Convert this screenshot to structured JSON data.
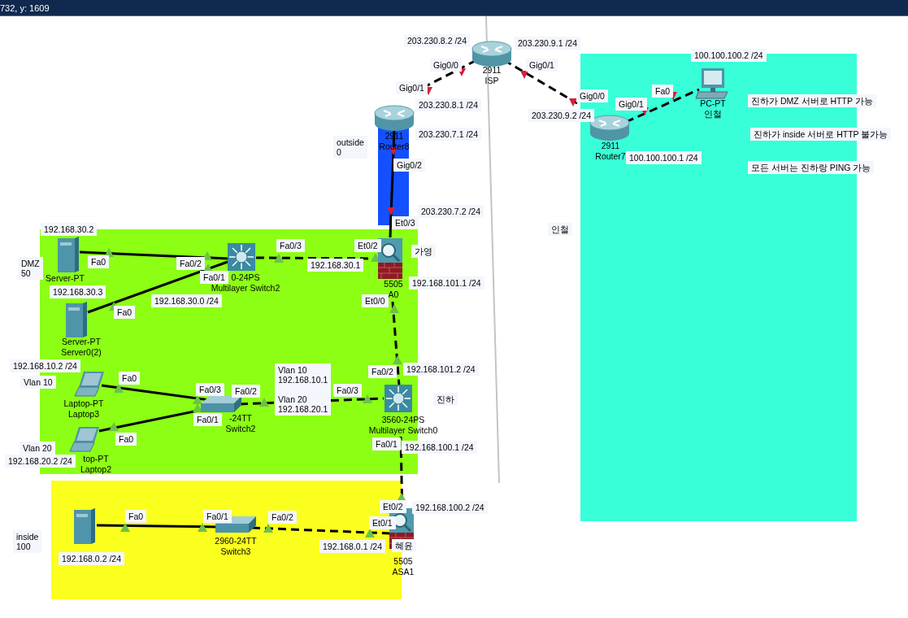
{
  "status_bar": {
    "text": "732, y: 1609"
  },
  "areas": [
    {
      "color": "#1450ff"
    },
    {
      "color": "#8cff14"
    },
    {
      "color": "#fbff1e"
    },
    {
      "color": "#38ffd8"
    }
  ],
  "devices": [
    {
      "kind": "router",
      "model": "2911",
      "name": "ISP"
    },
    {
      "kind": "pc",
      "model": "PC-PT",
      "name": "인철"
    },
    {
      "kind": "router",
      "model": "2911",
      "name": "Router8"
    },
    {
      "kind": "router",
      "model": "2911",
      "name": "Router7"
    },
    {
      "kind": "server",
      "model": "Server-PT"
    },
    {
      "kind": "multilayer-switch",
      "model": "0-24PS",
      "name": "Multilayer Switch2"
    },
    {
      "kind": "firewall",
      "model": "5505",
      "name": "A0"
    },
    {
      "kind": "server",
      "model": "Server-PT",
      "name": "Server0(2)"
    },
    {
      "kind": "laptop",
      "model": "Laptop-PT",
      "name": "Laptop3"
    },
    {
      "kind": "switch",
      "model": "-24TT",
      "name": "Switch2"
    },
    {
      "kind": "multilayer-switch",
      "model": "3560-24PS",
      "name": "Multilayer Switch0"
    },
    {
      "kind": "laptop",
      "model": "top-PT",
      "name": "Laptop2"
    },
    {
      "kind": "server"
    },
    {
      "kind": "switch",
      "model": "2960-24TT",
      "name": "Switch3"
    },
    {
      "kind": "firewall",
      "model": "5505",
      "name": "ASA1"
    }
  ],
  "links": [
    {
      "crossover": true,
      "ends": [
        {
          "up": false
        },
        {
          "up": false
        }
      ]
    },
    {
      "crossover": true,
      "ends": [
        {
          "up": false
        },
        {
          "up": false
        }
      ]
    },
    {
      "crossover": true,
      "ends": [
        {
          "up": false
        },
        {
          "up": false
        }
      ]
    },
    {
      "crossover": false,
      "ends": [
        {
          "up": false
        },
        {
          "up": false
        }
      ]
    },
    {
      "crossover": true,
      "ends": [
        {
          "up": true
        },
        {
          "up": true
        }
      ]
    },
    {
      "crossover": true,
      "ends": [
        {
          "up": true
        },
        {
          "up": true
        }
      ]
    },
    {
      "crossover": false,
      "ends": [
        {
          "up": true
        },
        {
          "up": true
        }
      ]
    },
    {
      "crossover": false,
      "ends": [
        {
          "up": true
        },
        {
          "up": true
        }
      ]
    },
    {
      "crossover": false,
      "ends": [
        {
          "up": true
        },
        {
          "up": true
        }
      ]
    },
    {
      "crossover": false,
      "ends": [
        {
          "up": true
        },
        {
          "up": true
        }
      ]
    },
    {
      "crossover": true,
      "ends": [
        {
          "up": true
        },
        {
          "up": true
        }
      ]
    },
    {
      "crossover": true,
      "ends": [
        {
          "up": true
        },
        {
          "up": true
        }
      ]
    },
    {
      "crossover": false,
      "ends": [
        {
          "up": true
        },
        {
          "up": true
        }
      ]
    },
    {
      "crossover": true,
      "ends": [
        {
          "up": true
        },
        {
          "up": true
        }
      ]
    }
  ],
  "labels": [
    "203.230.8.2 /24",
    "203.230.9.1 /24",
    "Gig0/0",
    "Gig0/1",
    "100.100.100.2 /24",
    "Gig0/1",
    "203.230.8.1 /24",
    "Gig0/0",
    "Fa0",
    "Gig0/1",
    "203.230.9.2 /24",
    "진하가 DMZ 서버로 HTTP 가능",
    "203.230.7.1 /24",
    "outside\n0",
    "진하가 inside 서버로 HTTP 불가능",
    "Gig0/2",
    "100.100.100.1 /24",
    "모든 서버는 진하랑 PING 가능",
    "203.230.7.2 /24",
    "Et0/3",
    "인철",
    "192.168.30.2",
    "Fa0/3",
    "Et0/2",
    "가영",
    "DMZ\n50",
    "Fa0",
    "Fa0/2",
    "192.168.30.1",
    "Fa0/1",
    "192.168.30.3",
    "192.168.101.1 /24",
    "192.168.30.0 /24",
    "Fa0",
    "Et0/0",
    "192.168.10.2 /24",
    "Vlan 10",
    "Fa0",
    "Fa0/3",
    "Fa0/1",
    "Fa0/2",
    "Vlan 10\n192.168.10.1\n\nVlan 20\n192.168.20.1",
    "Fa0/3",
    "Fa0/2",
    "192.168.101.2 /24",
    "진하",
    "Fa0",
    "Vlan 20",
    "192.168.20.2 /24",
    "Fa0/1",
    "192.168.100.1 /24",
    "Et0/2",
    "192.168.100.2 /24",
    "Fa0",
    "Fa0/1",
    "Fa0/2",
    "Et0/1",
    "inside\n100",
    "192.168.0.1 /24",
    "혜윤",
    "192.168.0.2 /24"
  ]
}
